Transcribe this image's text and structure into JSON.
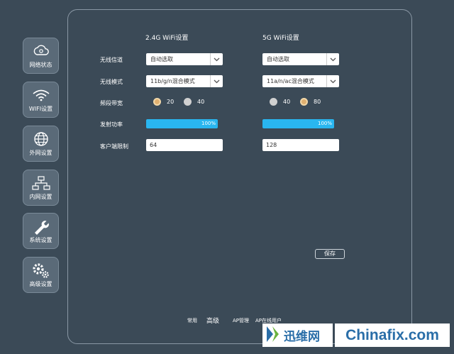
{
  "sidebar": {
    "items": [
      {
        "label": "网络状态",
        "icon": "cloud-icon"
      },
      {
        "label": "WIFI设置",
        "icon": "wifi-icon"
      },
      {
        "label": "外网设置",
        "icon": "globe-icon"
      },
      {
        "label": "内网设置",
        "icon": "network-icon"
      },
      {
        "label": "系统设置",
        "icon": "wrench-icon"
      },
      {
        "label": "高级设置",
        "icon": "gears-icon"
      }
    ]
  },
  "columns": {
    "band24": {
      "title": "2.4G WiFi设置"
    },
    "band5": {
      "title": "5G WiFi设置"
    }
  },
  "rows": {
    "channel": "无线信道",
    "mode": "无线模式",
    "bandwidth": "频段带宽",
    "power": "发射功率",
    "client_limit": "客户端限制"
  },
  "band24": {
    "channel": "自动选取",
    "mode": "11b/g/n混合模式",
    "bandwidth_options": [
      "20",
      "40"
    ],
    "bandwidth_selected": "20",
    "power": "100%",
    "power_value": 100,
    "client_limit": "64"
  },
  "band5": {
    "channel": "自动选取",
    "mode": "11a/n/ac混合模式",
    "bandwidth_options": [
      "40",
      "80"
    ],
    "bandwidth_selected": "80",
    "power": "100%",
    "power_value": 100,
    "client_limit": "128"
  },
  "save_label": "保存",
  "bottom_tabs": [
    {
      "label": "常用",
      "active": false
    },
    {
      "label": "高级",
      "active": true
    },
    {
      "label": "AP管理",
      "active": false
    },
    {
      "label": "AP在线用户",
      "active": false
    }
  ],
  "watermark": {
    "brand_cn": "迅维网",
    "brand_en": "Chinafix.com"
  },
  "colors": {
    "background": "#3b4a57",
    "sidebar_button": "#5a6a78",
    "power_bar": "#29b6f0",
    "radio_selected": "#e0b070",
    "watermark_blue": "#2a6ea8"
  }
}
